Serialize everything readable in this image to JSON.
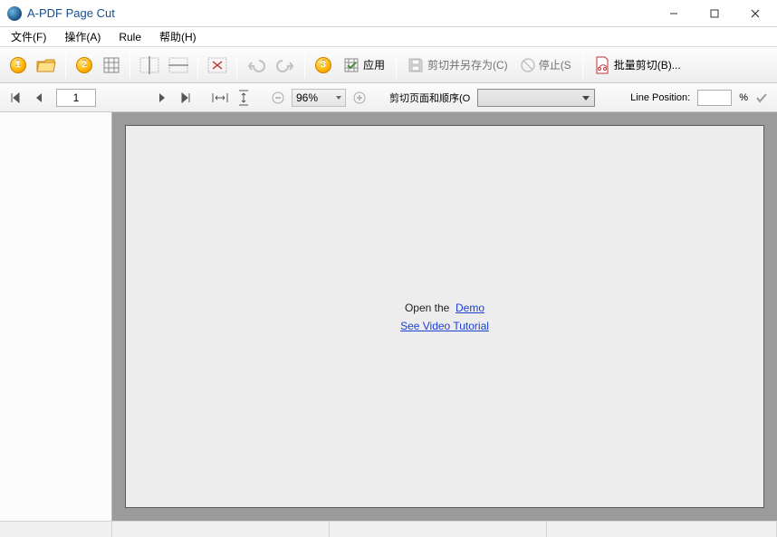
{
  "window": {
    "title": "A-PDF Page Cut"
  },
  "menu": {
    "file": "文件(F)",
    "action": "操作(A)",
    "rule": "Rule",
    "help": "帮助(H)"
  },
  "toolbar": {
    "step1": "1",
    "step2": "2",
    "step3": "3",
    "apply": "应用",
    "save_as": "剪切并另存为(C)",
    "stop": "停止(S",
    "batch": "批量剪切(B)..."
  },
  "nav": {
    "page_value": "1",
    "zoom_value": "96%",
    "cut_order_label": "剪切页面和顺序(O",
    "line_position_label": "Line Position:",
    "line_position_value": "",
    "percent": "%"
  },
  "canvas": {
    "open_text": "Open the",
    "demo_link": "Demo",
    "tutorial_link": "See Video Tutorial"
  }
}
